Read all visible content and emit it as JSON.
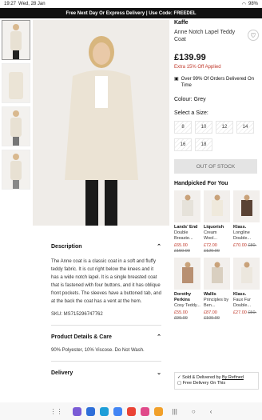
{
  "status": {
    "time": "19:27",
    "date": "Wed, 28 Jan",
    "battery": "98%"
  },
  "promo": "Free Next Day Or Express Delivery | Use Code: FREEDEL",
  "product": {
    "brand": "Kaffe",
    "name": "Anne Notch Lapel Teddy Coat",
    "price": "£139.99",
    "offer": "Extra 15% Off Applied",
    "delivery": "Over 99% Of Orders Delivered On Time",
    "colour": "Colour: Grey",
    "size_label": "Select a Size:",
    "sizes": [
      "8",
      "10",
      "12",
      "14",
      "16",
      "18"
    ],
    "cta": "OUT OF STOCK"
  },
  "handpicked": {
    "title": "Handpicked For You",
    "items": [
      {
        "brand": "Lands' End",
        "name": "Double Breaste...",
        "price": "£65.00",
        "was": "£150.00"
      },
      {
        "brand": "Liquorish",
        "name": "Cream Wool...",
        "price": "£72.00",
        "was": "£120.00"
      },
      {
        "brand": "Klass.",
        "name": "Longline Double...",
        "price": "£70.00",
        "was": "£80."
      },
      {
        "brand": "Dorothy Perkins",
        "name": "Cosy Teddy...",
        "price": "£55.00",
        "was": "£99.00"
      },
      {
        "brand": "Wallis",
        "name": "Principles by Ben...",
        "price": "£87.00",
        "was": "£109.00"
      },
      {
        "brand": "Klass.",
        "name": "Faux Fur Double...",
        "price": "£27.00",
        "was": "£50."
      }
    ]
  },
  "sold": {
    "prefix": "Sold & Delivered by",
    "seller": "By Refined",
    "free": "Free Delivery On This"
  },
  "description": {
    "title": "Description",
    "text": "The Anne coat is a classic coat in a soft and fluffy teddy fabric. It is cut right below the knees and it has a wide notch lapel. It is a single breasted coat that is fastened with four buttons, and it has oblique front pockets. The sleeves have a buttoned tab, and at the back the coat has a vent at the hem.",
    "sku": "SKU: MS715296747762"
  },
  "details": {
    "title": "Product Details & Care",
    "text": "90% Polyester, 10% Viscose. Do Not Wash."
  },
  "delivery_section": {
    "title": "Delivery"
  },
  "icons": {
    "heart": "heart-icon",
    "arrow": "chevron-right-icon"
  },
  "colors": {
    "accent": "#c0392b",
    "promo_bg": "#111111"
  }
}
